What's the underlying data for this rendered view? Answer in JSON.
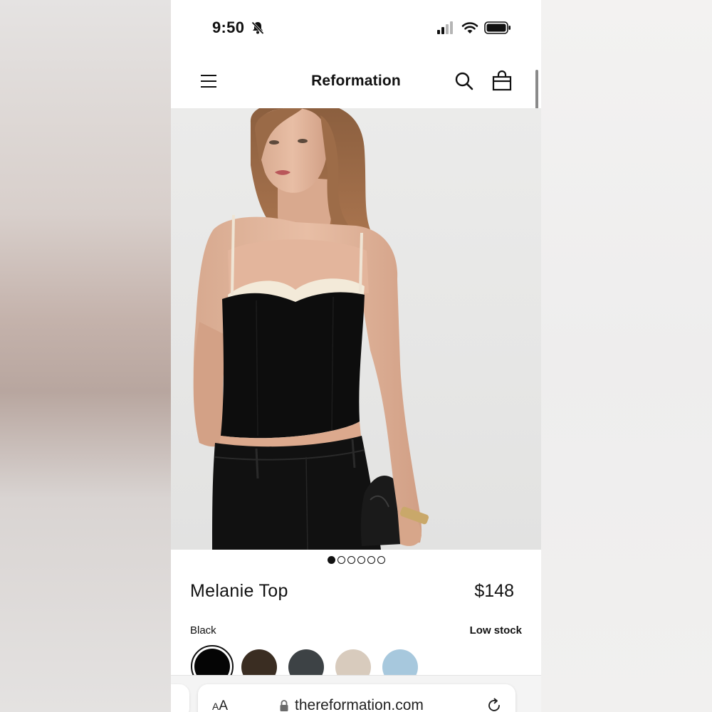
{
  "status_bar": {
    "time": "9:50",
    "icons": [
      "bell-slash-icon",
      "cellular-signal-icon",
      "wifi-icon",
      "battery-icon"
    ]
  },
  "nav": {
    "brand": "Reformation",
    "icons": [
      "menu-icon",
      "search-icon",
      "shopping-bag-icon"
    ]
  },
  "gallery": {
    "image": "product-photo-model-wearing-black-corset-top",
    "dot_count": 6,
    "active_index": 0
  },
  "product": {
    "name": "Melanie Top",
    "price": "$148",
    "color_name": "Black",
    "stock_status": "Low stock",
    "swatches": [
      {
        "name": "black-swatch",
        "color": "#050505",
        "selected": true
      },
      {
        "name": "brown-swatch",
        "color": "#3a2d22",
        "selected": false
      },
      {
        "name": "charcoal-swatch",
        "color": "#3d4245",
        "selected": false
      },
      {
        "name": "cream-swatch",
        "color": "#d8cbbd",
        "selected": false
      },
      {
        "name": "light-blue-swatch",
        "color": "#a7c8dd",
        "selected": false
      }
    ]
  },
  "browser": {
    "text_size_label_small": "A",
    "text_size_label_large": "A",
    "url": "thereformation.com",
    "icons": [
      "lock-icon",
      "reload-icon"
    ]
  },
  "colors": {
    "text": "#111111",
    "background": "#ffffff",
    "photo_background": "#e8e8e7"
  }
}
